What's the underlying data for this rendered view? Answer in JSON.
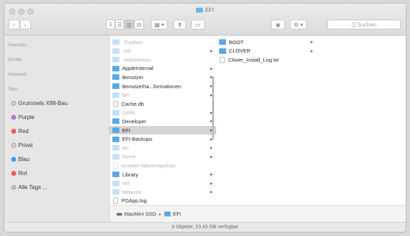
{
  "window": {
    "title": "EFI"
  },
  "toolbar": {
    "back_icon": "chevron-left",
    "forward_icon": "chevron-right",
    "view_icons": [
      "⠿",
      "☰",
      "▥",
      "⊟"
    ],
    "arrange_icon": "▦ ▾",
    "share_icon": "⬆",
    "tag_icon": "▭",
    "eye_icon": "◉",
    "action_icon": "⚙ ▾",
    "search_placeholder": "Q Suchen"
  },
  "sidebar": {
    "sections": [
      "Favoriten",
      "Geräte",
      "Netzwerk",
      "Tags"
    ],
    "tags": [
      {
        "label": "Grummels X99-Bau",
        "color": "#d0d0d0"
      },
      {
        "label": "Purple",
        "color": "#b678d8"
      },
      {
        "label": "Red",
        "color": "#f25a54"
      },
      {
        "label": "Privat",
        "color": "#d0d0d0"
      },
      {
        "label": "Blau",
        "color": "#3d9bf0"
      },
      {
        "label": "Rot",
        "color": "#f25a54"
      },
      {
        "label": "Alle Tags ...",
        "color": "#c0c0c0"
      }
    ]
  },
  "column1": {
    "items": [
      {
        "label": ".Trashes",
        "kind": "faded",
        "chevron": ""
      },
      {
        "label": ".vol",
        "kind": "faded",
        "chevron": "▸"
      },
      {
        "label": ".VolumeIcon",
        "kind": "faded",
        "chevron": ""
      },
      {
        "label": "AppleInternal",
        "kind": "blue",
        "chevron": "▸"
      },
      {
        "label": "Benutzer",
        "kind": "blue",
        "chevron": "▸"
      },
      {
        "label": "Benutzerha...formationen",
        "kind": "blue",
        "chevron": "▸"
      },
      {
        "label": "bin",
        "kind": "faded",
        "chevron": "▸"
      },
      {
        "label": "Cache.db",
        "kind": "doc",
        "chevron": ""
      },
      {
        "label": "cores",
        "kind": "faded",
        "chevron": "▸"
      },
      {
        "label": "Developer",
        "kind": "blue",
        "chevron": "▸"
      },
      {
        "label": "EFI",
        "kind": "blue",
        "chevron": "▸",
        "selected": true
      },
      {
        "label": "EFI-Backups",
        "kind": "blue",
        "chevron": "▸"
      },
      {
        "label": "etc",
        "kind": "faded",
        "chevron": "▸"
      },
      {
        "label": "home",
        "kind": "faded",
        "chevron": "▸"
      },
      {
        "label": "installer.failurerequests",
        "kind": "docfaded",
        "chevron": ""
      },
      {
        "label": "Library",
        "kind": "blue",
        "chevron": "▸"
      },
      {
        "label": "net",
        "kind": "faded",
        "chevron": "▸"
      },
      {
        "label": "Network",
        "kind": "faded",
        "chevron": "▸"
      },
      {
        "label": "PDApp.log",
        "kind": "doc",
        "chevron": ""
      }
    ]
  },
  "column2": {
    "items": [
      {
        "label": "BOOT",
        "kind": "blue",
        "chevron": "▸"
      },
      {
        "label": "CLOVER",
        "kind": "blue",
        "chevron": "▸"
      },
      {
        "label": "Clover_Install_Log.txt",
        "kind": "doc",
        "chevron": ""
      }
    ]
  },
  "pathbar": {
    "drive": "MacMini SSD",
    "separator": "▸",
    "folder": "EFI"
  },
  "status": {
    "text": "3 Objekte, 23,43 GB verfügbar"
  }
}
